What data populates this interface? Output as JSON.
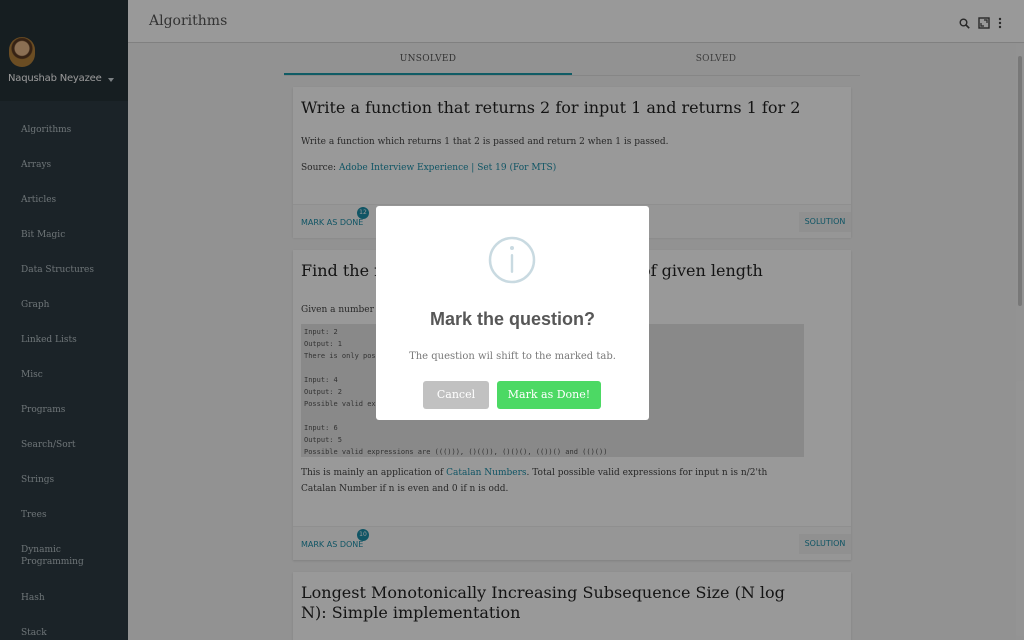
{
  "sidebar": {
    "profile_name": "Naqushab Neyazee",
    "items": [
      {
        "label": "Algorithms"
      },
      {
        "label": "Arrays"
      },
      {
        "label": "Articles"
      },
      {
        "label": "Bit Magic"
      },
      {
        "label": "Data Structures"
      },
      {
        "label": "Graph"
      },
      {
        "label": "Linked Lists"
      },
      {
        "label": "Misc"
      },
      {
        "label": "Programs"
      },
      {
        "label": "Search/Sort"
      },
      {
        "label": "Strings"
      },
      {
        "label": "Trees"
      },
      {
        "label": "Dynamic Programming"
      },
      {
        "label": "Hash"
      },
      {
        "label": "Stack"
      }
    ]
  },
  "topbar": {
    "title": "Algorithms",
    "icons": [
      "search-icon",
      "fullscreen-icon",
      "more-vert-icon"
    ]
  },
  "tabs": [
    {
      "label": "UNSOLVED",
      "active": true
    },
    {
      "label": "SOLVED",
      "active": false
    }
  ],
  "cards": [
    {
      "title": "Write a function that returns 2 for input 1 and returns 1 for 2",
      "text": "Write a function which returns 1 that 2 is passed and return 2 when 1 is passed.",
      "source_prefix": "Source: ",
      "source_link": "Adobe Interview Experience | Set 19 (For MTS)",
      "mark_done": "MARK AS DONE",
      "badge": "12",
      "solution": "SOLUTION"
    },
    {
      "title_left": "Find the nu",
      "title_right": "of given length",
      "intro": "Given a number n",
      "code": "Input: 2\nOutput: 1\nThere is only poss\n\nInput: 4\nOutput: 2\nPossible valid exp\n\nInput: 6\nOutput: 5\nPossible valid expressions are ((())), ()(()), ()()(), (())() and (()())",
      "text_prefix": "This is mainly an application of ",
      "text_link": "Catalan Numbers",
      "text_suffix": ". Total possible valid expressions for input n is n/2'th Catalan Number if n is even and 0 if n is odd.",
      "mark_done": "MARK AS DONE",
      "badge": "10",
      "solution": "SOLUTION"
    },
    {
      "title": "Longest Monotonically Increasing Subsequence Size (N log N): Simple implementation"
    }
  ],
  "modal": {
    "icon": "info-icon",
    "title": "Mark the question?",
    "text": "The question wil shift to the marked tab.",
    "cancel_label": "Cancel",
    "confirm_label": "Mark as Done!"
  },
  "colors": {
    "accent": "#1c8ea8",
    "sidebar_bg": "#2d3b43",
    "confirm": "#4cd964",
    "cancel": "#c1c1c1"
  }
}
